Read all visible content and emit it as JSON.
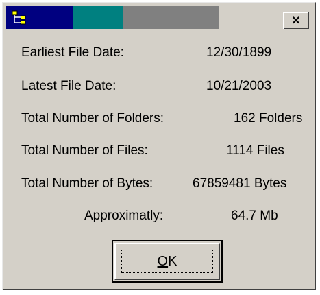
{
  "titlebar": {
    "icon": "tree-folder-icon",
    "close_label": "×",
    "colors": {
      "primary": "#000080",
      "secondary": "#008080",
      "tertiary": "#808080"
    }
  },
  "stats": {
    "earliest_label": "Earliest File Date:",
    "earliest_value": "12/30/1899",
    "latest_label": "Latest File Date:",
    "latest_value": "10/21/2003",
    "folders_label": "Total Number of Folders:",
    "folders_value": "162 Folders",
    "files_label": "Total Number of Files:",
    "files_value": "1114 Files",
    "bytes_label": "Total Number of Bytes:",
    "bytes_value": "67859481 Bytes",
    "approx_label": "Approximatly:",
    "approx_value": "64.7 Mb"
  },
  "ok_button": {
    "mnemonic": "O",
    "rest": "K"
  }
}
